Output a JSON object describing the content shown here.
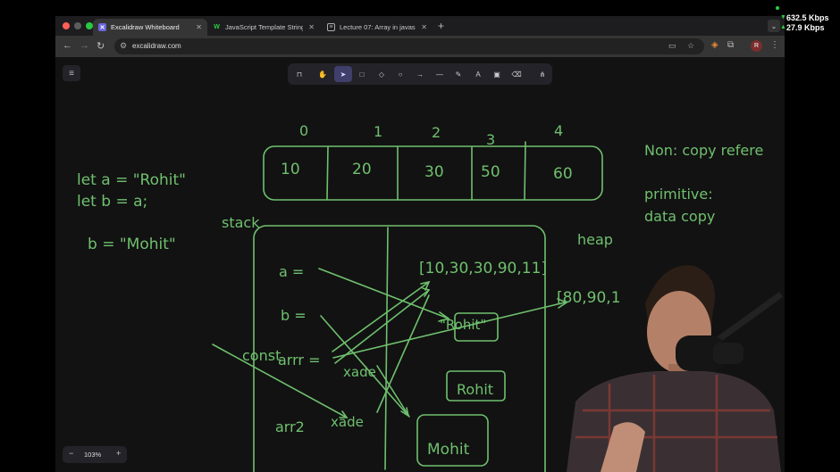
{
  "browser": {
    "tabs": [
      {
        "title": "Excalidraw Whiteboard",
        "active": true,
        "favicon": "excalidraw-logo"
      },
      {
        "title": "JavaScript Template Strings",
        "active": false,
        "favicon": "w3-logo"
      },
      {
        "title": "Lecture 07: Array in javascript",
        "active": false,
        "favicon": "document-icon"
      }
    ],
    "url": "excalidraw.com",
    "profile_initial": "R"
  },
  "excalidraw": {
    "zoom": "103%",
    "tools": [
      "lock-icon",
      "hand-icon",
      "selection-icon",
      "rectangle-icon",
      "diamond-icon",
      "ellipse-icon",
      "arrow-icon",
      "line-icon",
      "pencil-icon",
      "text-icon",
      "image-icon",
      "eraser-icon",
      "library-icon"
    ],
    "selected_tool": "selection-icon"
  },
  "drawing": {
    "code_lines": [
      "let a = \"Rohit\"",
      "let b = a;",
      "b = \"Mohit\""
    ],
    "array_indices": [
      "0",
      "1",
      "2",
      "3",
      "4"
    ],
    "array_values": [
      "10",
      "20",
      "30",
      "50",
      "60"
    ],
    "notes": [
      "Non: copy refere",
      "primitive:",
      "data copy"
    ],
    "stack_label": "stack",
    "heap_label": "heap",
    "stack_vars": [
      "a =",
      "b =",
      "arrr =",
      "arr2"
    ],
    "const_label": "const",
    "addresses": [
      "xade",
      "xade"
    ],
    "heap_arrays": [
      "[10,30,30,90,11]",
      "[80,90,1"
    ],
    "heap_strings": [
      "\"Rohit\"",
      "Rohit",
      "Mohit"
    ],
    "stroke_color": "#6fc06e"
  },
  "network": {
    "down": "632.5 Kbps",
    "up": "27.9 Kbps",
    "indicator_color": "#2ecc40"
  }
}
